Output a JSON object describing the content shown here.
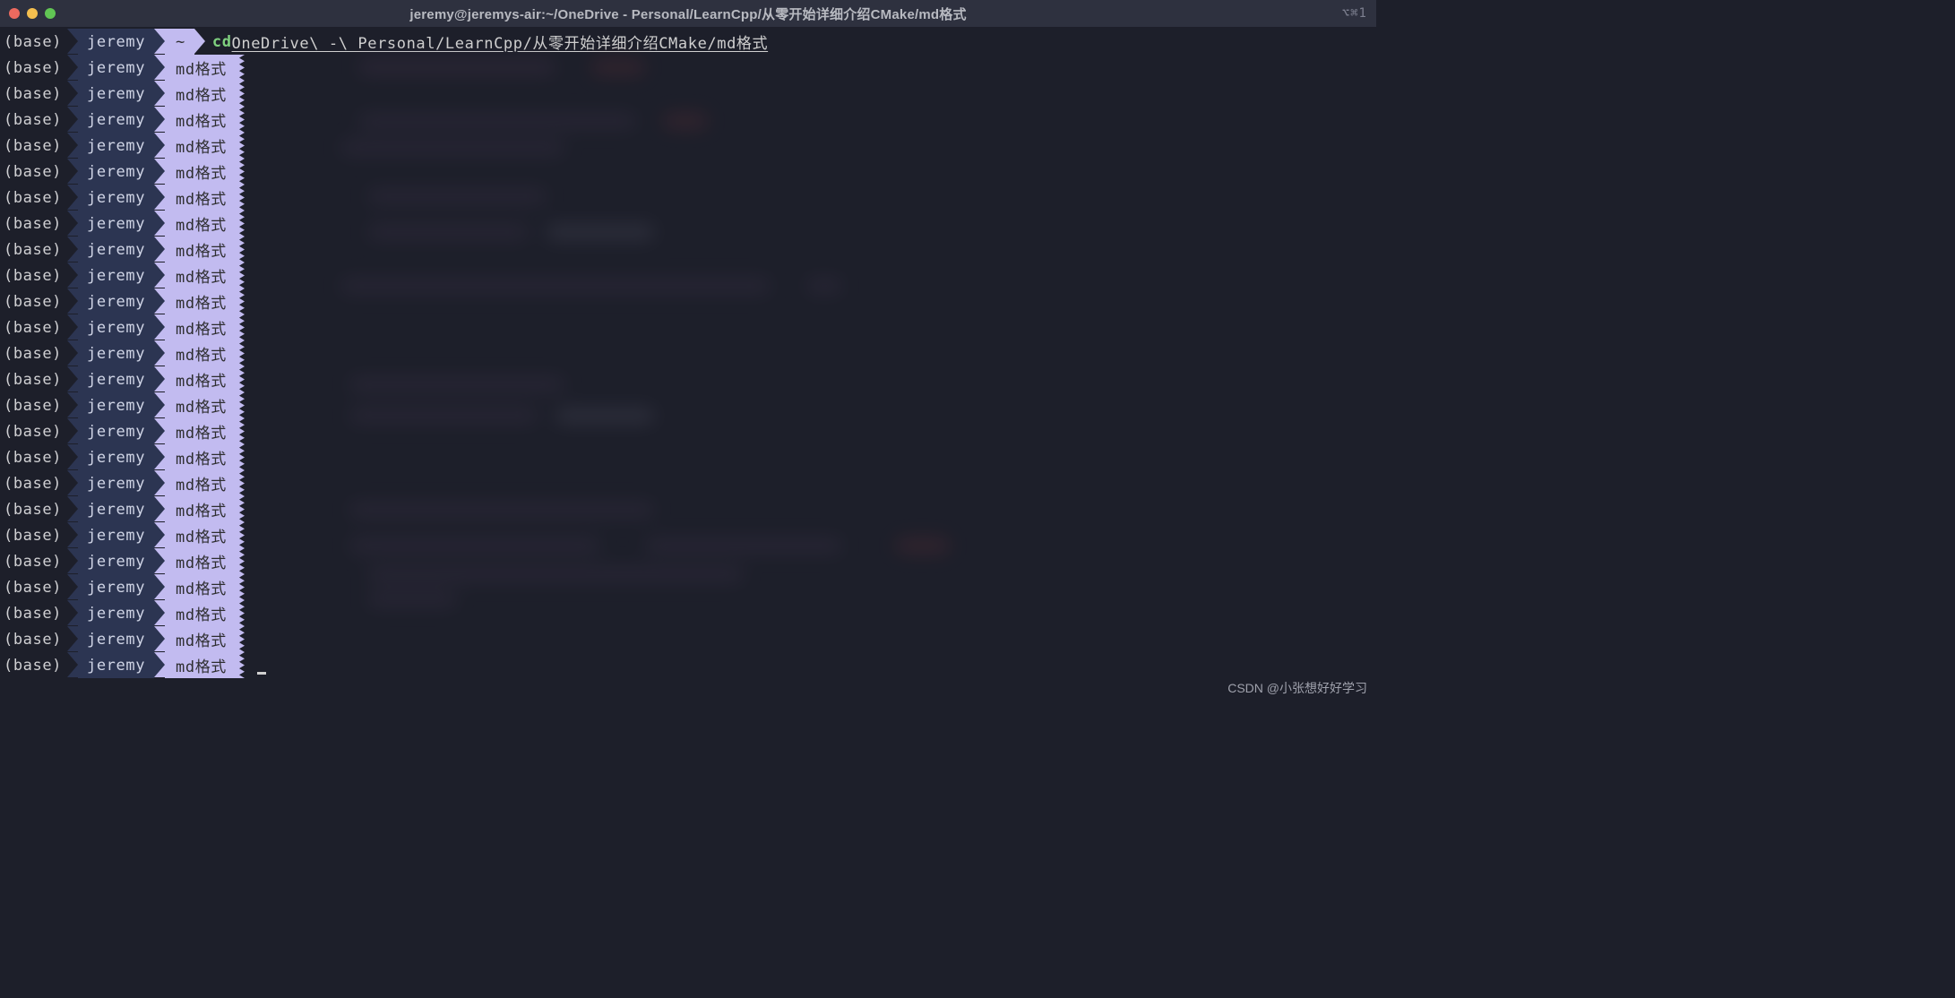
{
  "window": {
    "title": "jeremy@jeremys-air:~/OneDrive - Personal/LearnCpp/从零开始详细介绍CMake/md格式",
    "tab_indicator": "⌥⌘1"
  },
  "prompt": {
    "env": "(base)",
    "user": "jeremy",
    "home_dir": "~",
    "work_dir": "md格式"
  },
  "first_line": {
    "cd": "cd",
    "path": "OneDrive\\ -\\ Personal/LearnCpp/从零开始详细介绍CMake/md格式"
  },
  "repeat_count": 24,
  "watermark": "CSDN @小张想好好学习"
}
